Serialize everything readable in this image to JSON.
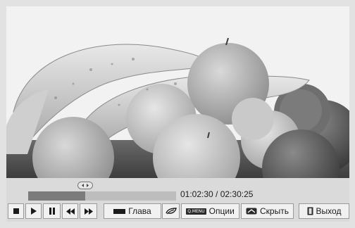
{
  "player": {
    "progress_fraction": 0.385,
    "time_display": "01:02:30 / 02:30:25"
  },
  "controls": {
    "stop_icon": "stop-icon",
    "play_icon": "play-icon",
    "pause_icon": "pause-icon",
    "rewind_icon": "rewind-icon",
    "forward_icon": "fast-forward-icon",
    "chapter_label": "Глава",
    "eco_icon": "eco-icon",
    "options_chip": "Q.MENU",
    "options_label": "Опции",
    "hide_label": "Скрыть",
    "exit_label": "Выход"
  },
  "colors": {
    "bar_bg": "#dadada",
    "progress_fill": "#7b7b7b",
    "progress_track": "#bdbdbd"
  }
}
